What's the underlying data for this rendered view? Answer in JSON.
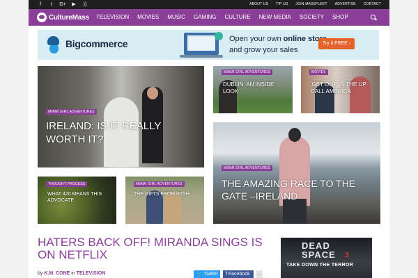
{
  "topbar": {
    "social_icons": [
      "f",
      "t",
      "G+",
      "▶",
      "))"
    ],
    "social_icon_names": [
      "facebook-icon",
      "twitter-icon",
      "googleplus-icon",
      "youtube-icon",
      "rss-icon"
    ],
    "links": [
      "ABOUT US",
      "TIP US",
      "JOIN MASSFLEET",
      "ADVERTISE",
      "CONTACT"
    ]
  },
  "nav": {
    "logo": "CultureMass",
    "items": [
      "TELEVISION",
      "MOVIES",
      "MUSIC",
      "GAMING",
      "CULTURE",
      "NEW MEDIA",
      "SOCIETY",
      "SHOP"
    ],
    "search_icon": "search-icon"
  },
  "ad_banner": {
    "brand": "Bigcommerce",
    "line1_pre": "Open your own ",
    "line1_bold": "online store",
    "line2": "and grow your sales",
    "cta": "Try it FREE ›"
  },
  "tiles": [
    {
      "category": "MIAMI GIRL ADVENTURES",
      "title": "IRELAND: IS IT REALLY WORTH IT?"
    },
    {
      "category": "MIAMI GIRL ADVENTURES",
      "title": "DUBLIN: AN INSIDE LOOK"
    },
    {
      "category": "MOVIES",
      "title": "'GET OUT' IS THE UP CALL AMERICA"
    },
    {
      "category": "MIAMI GIRL ADVENTURES",
      "title": "THE AMAZING RACE TO THE GATE –IRELAND"
    },
    {
      "category": "THOUGHT PROCESS",
      "title": "WHAT 420 MEANS THIS ADVOCATE"
    },
    {
      "category": "MIAMI GIRL ADVENTURES",
      "title": "THE GIFTS FROM IRISH"
    }
  ],
  "article": {
    "title": "HATERS BACK OFF! MIRANDA SINGS IS ON NETFLIX",
    "by": "by",
    "author": "K.M. CONE",
    "in": "in",
    "category": "TELEVISION",
    "share_twitter": "Twitter",
    "share_facebook": "Facebook",
    "share_more": "..."
  },
  "side_ad": {
    "line1": "DEAD",
    "line2": "SPACE",
    "number": "3",
    "tagline": "TAKE DOWN THE TERROR"
  },
  "colors": {
    "brand_purple": "#8a3e98",
    "topbar": "#1f1f1f",
    "twitter": "#2a9df4",
    "facebook": "#3b5998",
    "cta_orange": "#e5632a"
  }
}
